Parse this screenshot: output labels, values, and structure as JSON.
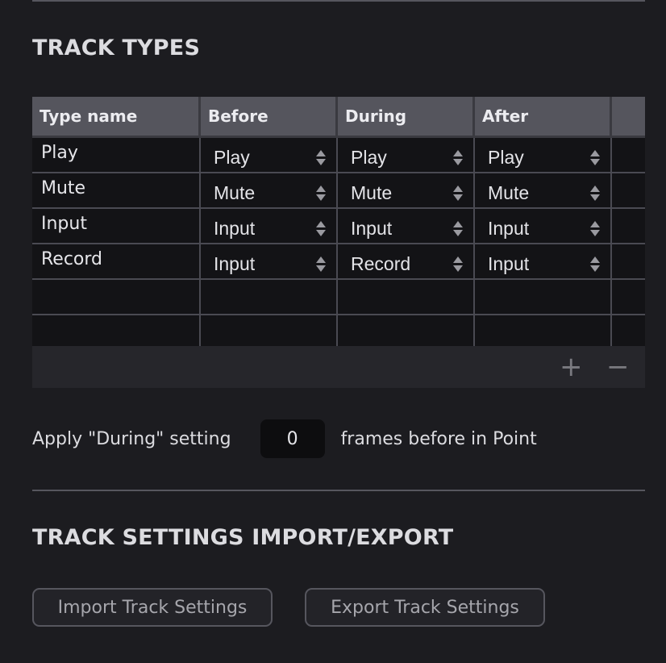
{
  "track_types": {
    "title": "TRACK TYPES",
    "columns": [
      "Type name",
      "Before",
      "During",
      "After"
    ],
    "rows": [
      {
        "name": "Play",
        "before": "Play",
        "during": "Play",
        "after": "Play"
      },
      {
        "name": "Mute",
        "before": "Mute",
        "during": "Mute",
        "after": "Mute"
      },
      {
        "name": "Input",
        "before": "Input",
        "during": "Input",
        "after": "Input"
      },
      {
        "name": "Record",
        "before": "Input",
        "during": "Record",
        "after": "Input"
      }
    ],
    "add_label": "+",
    "remove_label": "−"
  },
  "apply": {
    "prefix": "Apply \"During\" setting",
    "frames_value": "0",
    "suffix": "frames before in Point"
  },
  "import_export": {
    "title": "TRACK SETTINGS IMPORT/EXPORT",
    "import_label": "Import Track Settings",
    "export_label": "Export Track Settings"
  }
}
